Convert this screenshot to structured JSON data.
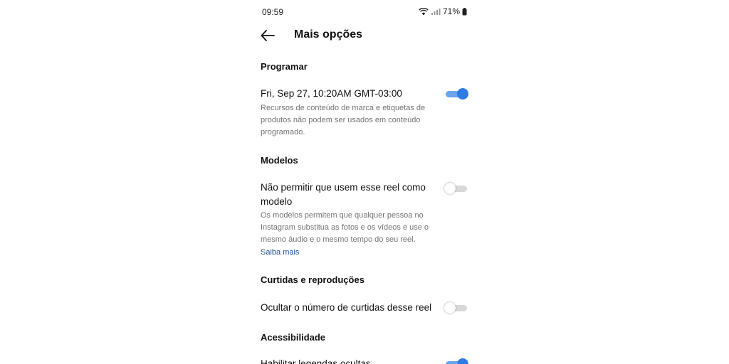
{
  "status_bar": {
    "time": "09:59",
    "battery": "71%",
    "icons": [
      "wifi-icon",
      "signal-icon",
      "battery-icon"
    ]
  },
  "header": {
    "title": "Mais opções",
    "back_icon": "arrow-left-icon"
  },
  "sections": {
    "programar": {
      "title": "Programar",
      "row_title": "Fri, Sep 27, 10:20AM GMT-03:00",
      "row_desc": "Recursos de conteúdo de marca e etiquetas de produtos não podem ser usados em conteúdo programado.",
      "toggle_on": true
    },
    "modelos": {
      "title": "Modelos",
      "row_title": "Não permitir que usem esse reel como modelo",
      "row_desc": "Os modelos permitem que qualquer pessoa no Instagram substitua as fotos e os vídeos e use o mesmo áudio e o mesmo tempo do seu reel.",
      "link": "Saiba mais",
      "toggle_on": false
    },
    "curtidas": {
      "title": "Curtidas e reproduções",
      "row_title": "Ocultar o número de curtidas desse reel",
      "toggle_on": false
    },
    "acessibilidade": {
      "title": "Acessibilidade",
      "row_title": "Habilitar legendas ocultas",
      "toggle_on": true
    }
  },
  "colors": {
    "toggle_on_knob": "#2f7be6",
    "toggle_on_track": "#6aa3ee",
    "toggle_off_track": "#d8d8d8",
    "link": "#1e4f8c",
    "secondary_text": "#737373"
  }
}
